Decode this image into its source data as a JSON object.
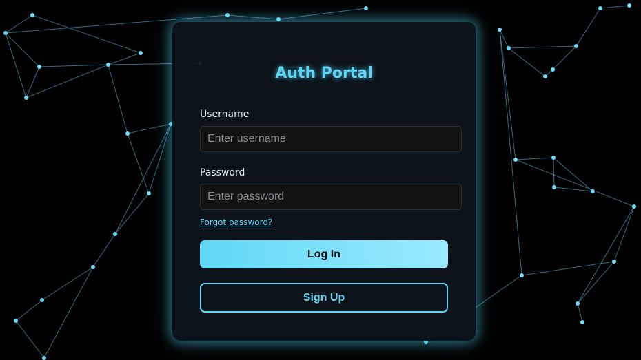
{
  "login_card": {
    "title": "Auth Portal",
    "username": {
      "label": "Username",
      "placeholder": "Enter username",
      "value": ""
    },
    "password": {
      "label": "Password",
      "placeholder": "Enter password",
      "value": ""
    },
    "forgot_password_label": "Forgot password?",
    "login_button_label": "Log In",
    "signup_button_label": "Sign Up"
  },
  "colors": {
    "background": "#000000",
    "card": "#0d141c",
    "accent": "#5fd6f6",
    "accent_light": "#9aebfd",
    "input_background": "#121212",
    "text": "#e6edf2",
    "placeholder": "#8a8f93"
  }
}
